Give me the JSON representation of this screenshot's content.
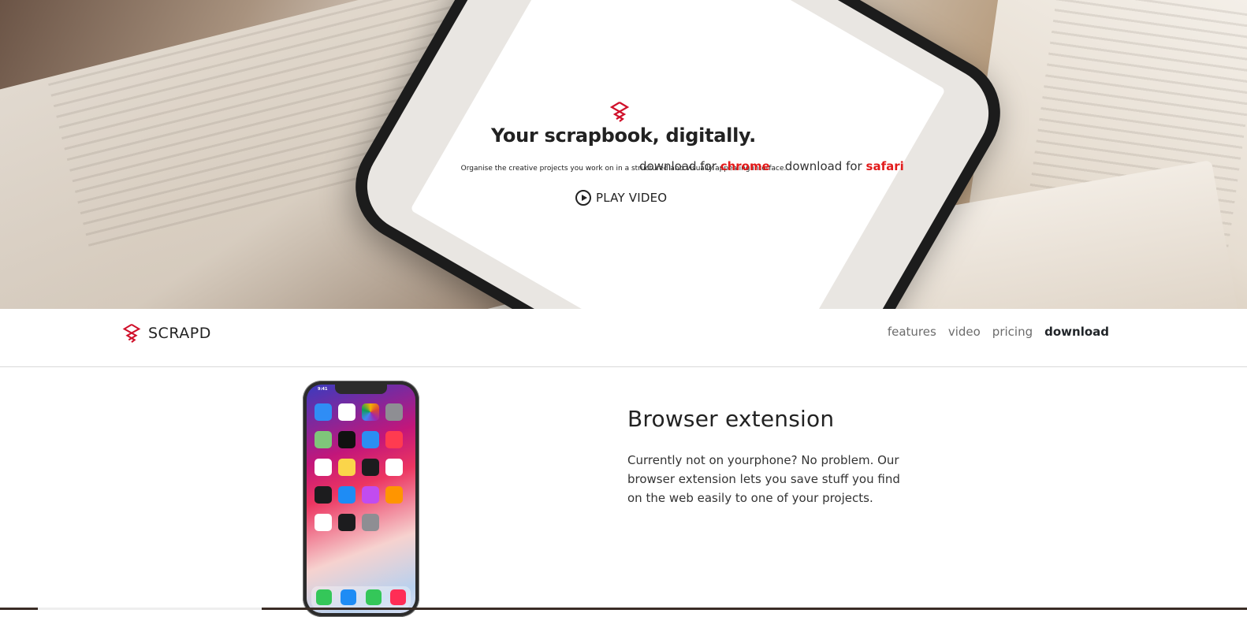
{
  "hero": {
    "title": "Your scrapbook, digitally.",
    "subtitle": "Organise the creative projects you work on in a structured and visually appealing interface.",
    "play_label": "PLAY VIDEO"
  },
  "nav": {
    "brand": "SCRAPD",
    "links": [
      {
        "label": "features",
        "active": false
      },
      {
        "label": "video",
        "active": false
      },
      {
        "label": "pricing",
        "active": false
      },
      {
        "label": "download",
        "active": true
      }
    ]
  },
  "extension": {
    "heading": "Browser extension",
    "body": "Currently not on yourphone? No problem. Our browser extension lets you save stuff you find on the web easily to one of your projects.",
    "download_prefix": "download for",
    "chrome": "chrome",
    "safari": "safari"
  },
  "phone_mockup": {
    "time": "9:41"
  },
  "colors": {
    "accent": "#e21b1b",
    "logo": "#d0102a",
    "text": "#212529"
  },
  "icons": [
    "scrapd-logo-icon",
    "play-circle-icon"
  ]
}
